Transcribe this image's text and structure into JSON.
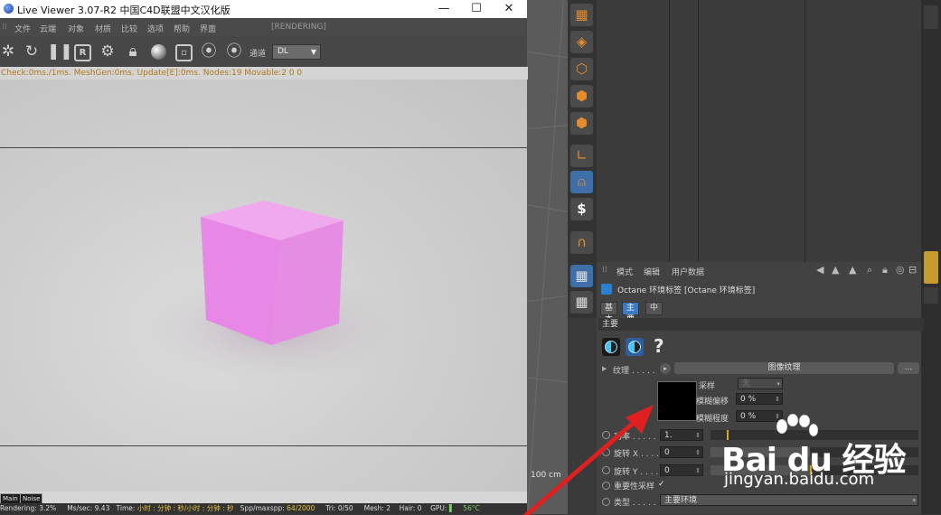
{
  "live_viewer": {
    "title": "Live Viewer 3.07-R2 中国C4D联盟中文汉化版",
    "menu": [
      "文件",
      "云端",
      "对象",
      "材质",
      "比较",
      "选项",
      "帮助",
      "界面"
    ],
    "rendering_label": "[RENDERING]",
    "channel_label": "通道",
    "channel_value": "DL",
    "status_line": "Check:0ms./1ms. MeshGen:0ms. Update[E]:0ms. Nodes:19 Movable:2 0 0",
    "tabs": [
      "Main",
      "Noise"
    ],
    "bottom": {
      "rendering": "Rendering: 3.2%",
      "ms_sec": "Ms/sec: 9.43",
      "time_label": "Time:",
      "time_value": "小时 : 分钟 : 秒/小时 : 分钟 : 秒",
      "spp_label": "Spp/maxspp:",
      "spp_value": "64/2000",
      "tri": "Tri: 0/50",
      "mesh": "Mesh: 2",
      "hair": "Hair: 0",
      "gpu": "GPU:",
      "temp": "56°C"
    },
    "icons": [
      "settings-icon",
      "refresh-icon",
      "pause-icon",
      "r-icon",
      "gear-icon",
      "lock-icon",
      "sphere-icon",
      "region-icon",
      "pin-icon",
      "pin-h-icon"
    ]
  },
  "viewport": {
    "scale_readout": "100 cm"
  },
  "attribute_manager": {
    "menu": [
      "模式",
      "编辑",
      "用户数据"
    ],
    "tag_title": "Octane 环境标签 [Octane 环境标签]",
    "tabs": [
      "基本",
      "主要",
      "中"
    ],
    "active_tab": "主要",
    "section": "主要",
    "help": "?",
    "texture_label": "纹理 . . . . .",
    "texture_button": "图像纹理",
    "texture_more": "...",
    "sampling_label": "采样",
    "sampling_value": "无",
    "blur_offset_label": "模糊偏移",
    "blur_offset_value": "0 %",
    "blur_amount_label": "模糊程度",
    "blur_amount_value": "0 %",
    "power_label": "功率 . . . . .",
    "power_value": "1.",
    "rot_x_label": "旋转 X . . . .",
    "rot_x_value": "0",
    "rot_y_label": "旋转 Y . . . .",
    "rot_y_value": "0",
    "importance_label": "重要性采样",
    "importance_check": "✓",
    "type_label": "类型 . . . . .",
    "type_value": "主要环境"
  },
  "watermark": {
    "brand": "Bai du 经验",
    "url": "jingyan.baidu.com"
  },
  "colors": {
    "cube": "#e68ae3",
    "accent": "#3c7bc4",
    "status": "#b0781a",
    "arrow": "#e02020"
  }
}
